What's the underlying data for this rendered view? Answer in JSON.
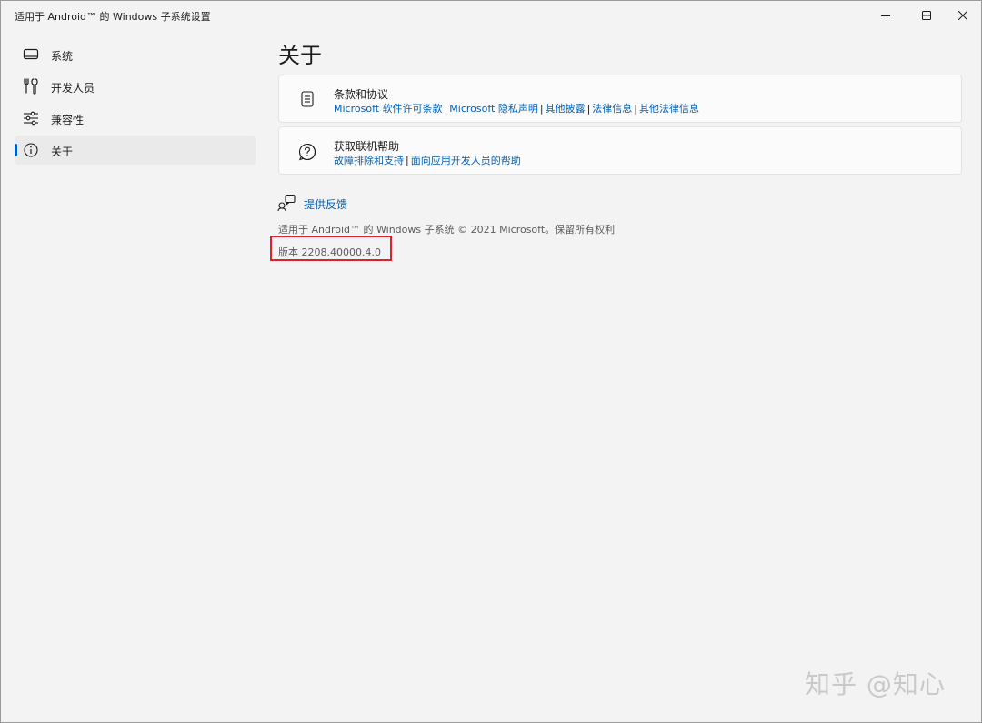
{
  "window": {
    "title": "适用于 Android™ 的 Windows 子系统设置"
  },
  "sidebar": {
    "items": [
      {
        "label": "系统",
        "icon": "laptop-icon",
        "selected": false
      },
      {
        "label": "开发人员",
        "icon": "tools-icon",
        "selected": false
      },
      {
        "label": "兼容性",
        "icon": "sliders-icon",
        "selected": false
      },
      {
        "label": "关于",
        "icon": "info-icon",
        "selected": true
      }
    ]
  },
  "main": {
    "title": "关于",
    "cards": [
      {
        "title": "条款和协议",
        "icon": "document-icon",
        "links": [
          "Microsoft 软件许可条款",
          "Microsoft 隐私声明",
          "其他披露",
          "法律信息",
          "其他法律信息"
        ]
      },
      {
        "title": "获取联机帮助",
        "icon": "help-icon",
        "links": [
          "故障排除和支持",
          "面向应用开发人员的帮助"
        ]
      }
    ],
    "feedback_label": "提供反馈",
    "copyright": "适用于 Android™ 的 Windows 子系统 © 2021 Microsoft。保留所有权利",
    "version": "版本 2208.40000.4.0"
  },
  "watermark": "知乎 @知心",
  "colors": {
    "accent": "#005fb8",
    "highlight": "#e0202a",
    "background": "#f3f3f3",
    "card": "#fbfbfb"
  }
}
